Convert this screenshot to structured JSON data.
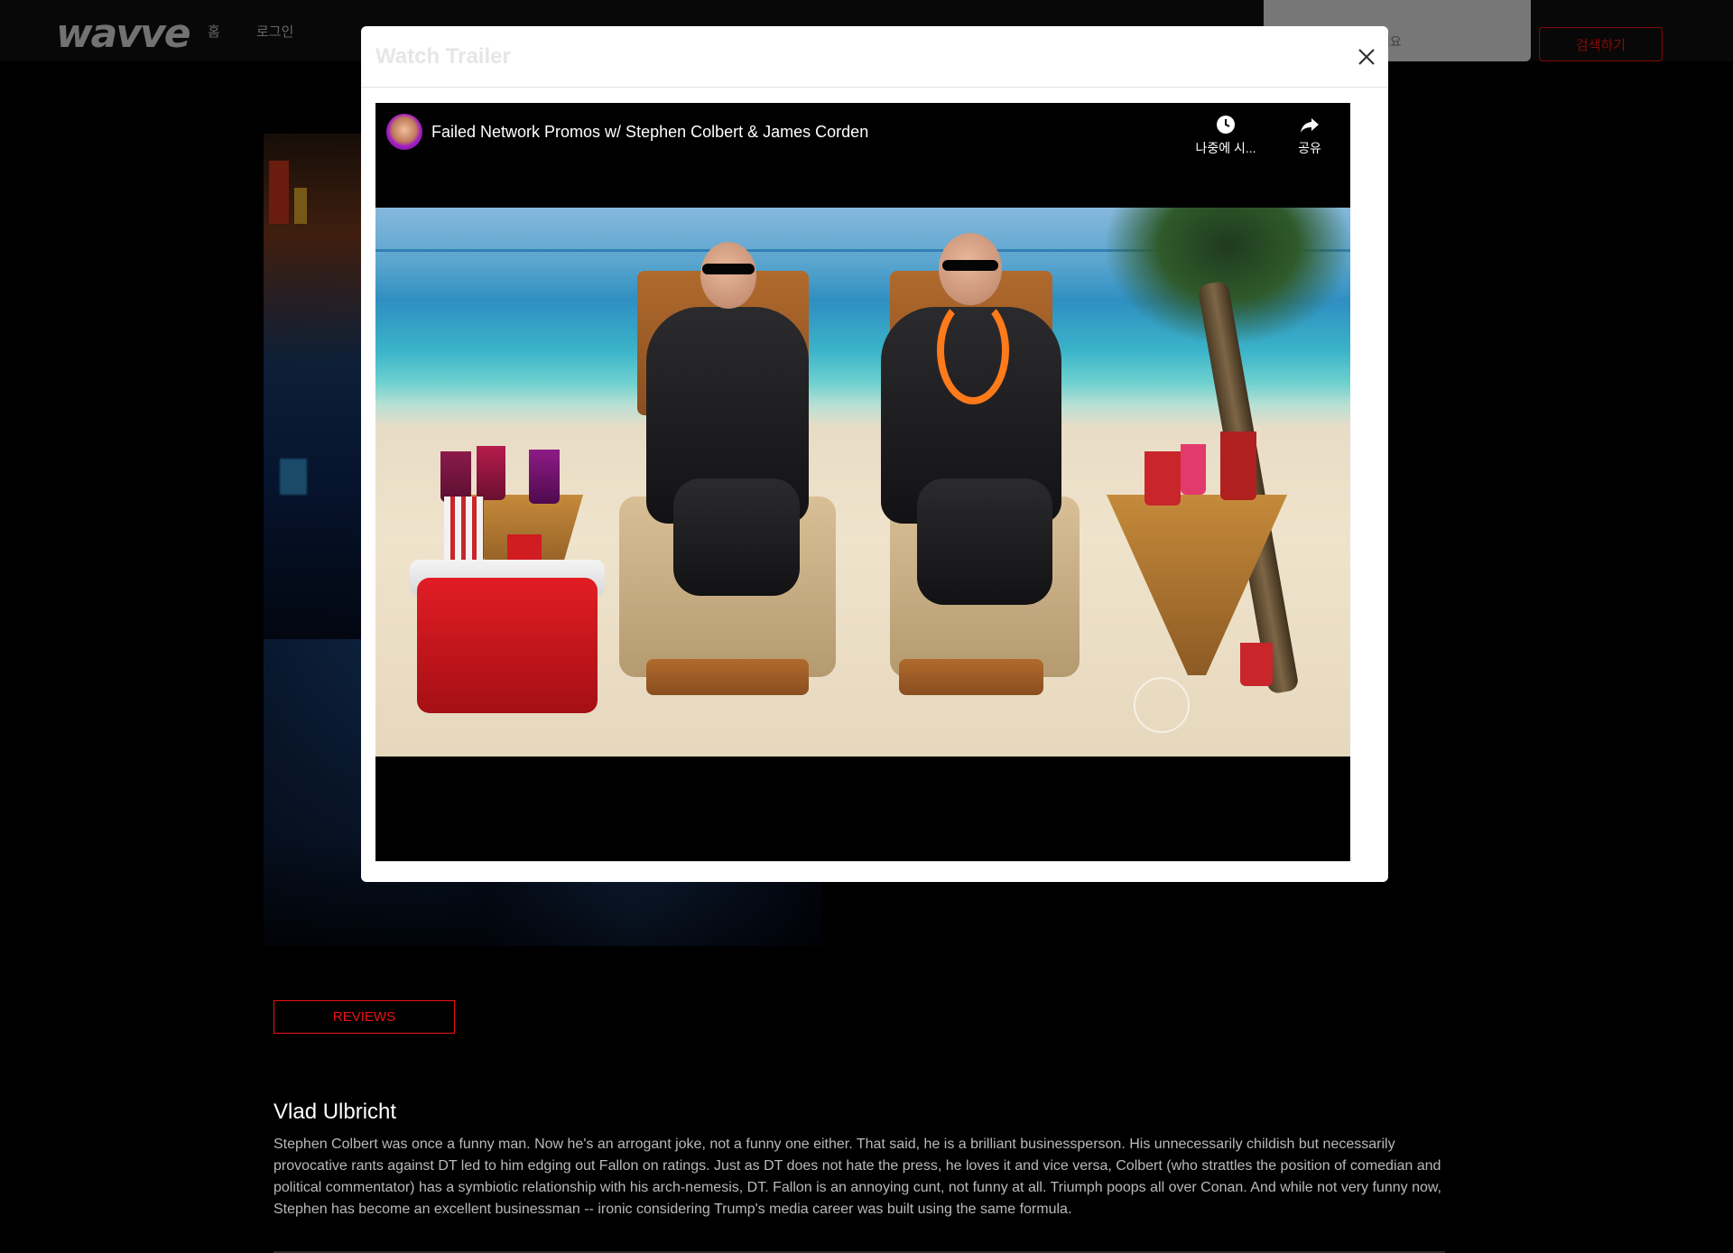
{
  "navbar": {
    "logo": "wavve",
    "home_link": "홈",
    "login_link": "로그인",
    "search_placeholder": "검색어를 입력해 주세요",
    "search_button": "검색하기"
  },
  "modal": {
    "title": "Watch Trailer",
    "close_icon": "close-icon"
  },
  "player": {
    "video_title": "Failed Network Promos w/ Stephen Colbert & James Corden",
    "watch_later_label": "나중에 시...",
    "share_label": "공유"
  },
  "reviews": {
    "button_label": "REVIEWS",
    "author": "Vlad Ulbricht",
    "text": "Stephen Colbert was once a funny man. Now he's an arrogant joke, not a funny one either. That said, he is a brilliant businessperson. His unnecessarily childish but necessarily provocative rants against DT led to him edging out Fallon on ratings. Just as DT does not hate the press, he loves it and vice versa, Colbert (who strattles the position of comedian and political commentator) has a symbiotic relationship with his arch-nemesis, DT. Fallon is an annoying cunt, not funny at all. Triumph poops all over Conan. And while not very funny now, Stephen has become an excellent businessman -- ironic considering Trump's media career was built using the same formula."
  },
  "colors": {
    "accent": "#ee1111",
    "background": "#000000",
    "navbar": "#101010"
  }
}
